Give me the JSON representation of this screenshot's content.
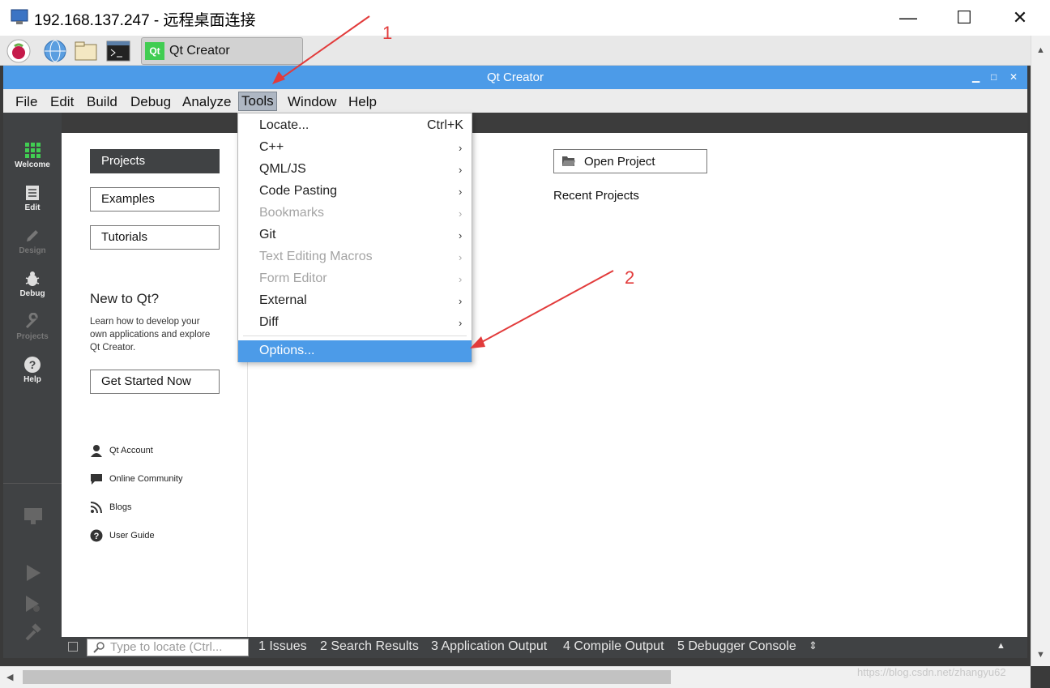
{
  "rdp": {
    "title": "192.168.137.247 - 远程桌面连接",
    "minimize": "—",
    "maximize": "☐",
    "close": "✕"
  },
  "taskbar": {
    "qt_task_label": "Qt Creator",
    "qt_badge": "Qt"
  },
  "qt": {
    "window_title": "Qt Creator",
    "menus": [
      "File",
      "Edit",
      "Build",
      "Debug",
      "Analyze",
      "Tools",
      "Window",
      "Help"
    ],
    "modes": [
      "Welcome",
      "Edit",
      "Design",
      "Debug",
      "Projects",
      "Help"
    ]
  },
  "welcome": {
    "buttons": [
      "Projects",
      "Examples",
      "Tutorials"
    ],
    "new_to_qt": "New to Qt?",
    "new_desc_1": "Learn how to develop your",
    "new_desc_2": "own applications and explore",
    "new_desc_3": "Qt Creator.",
    "get_started": "Get Started Now",
    "links": [
      "Qt Account",
      "Online Community",
      "Blogs",
      "User Guide"
    ],
    "open_project": "Open Project",
    "recent_projects": "Recent Projects"
  },
  "tools_menu": {
    "locate": "Locate...",
    "locate_shortcut": "Ctrl+K",
    "items": [
      "C++",
      "QML/JS",
      "Code Pasting",
      "Bookmarks",
      "Git",
      "Text Editing Macros",
      "Form Editor",
      "External",
      "Diff"
    ],
    "options": "Options..."
  },
  "output_bar": {
    "locator_placeholder": "Type to locate (Ctrl...",
    "panes": [
      "1  Issues",
      "2  Search Results",
      "3  Application Output",
      "4  Compile Output",
      "5  Debugger Console"
    ]
  },
  "annotations": {
    "one": "1",
    "two": "2"
  },
  "watermark": "https://blog.csdn.net/zhangyu62",
  "colors": {
    "accent": "#4c9be8",
    "sidebar": "#404244",
    "arrow": "#e23b3b"
  }
}
